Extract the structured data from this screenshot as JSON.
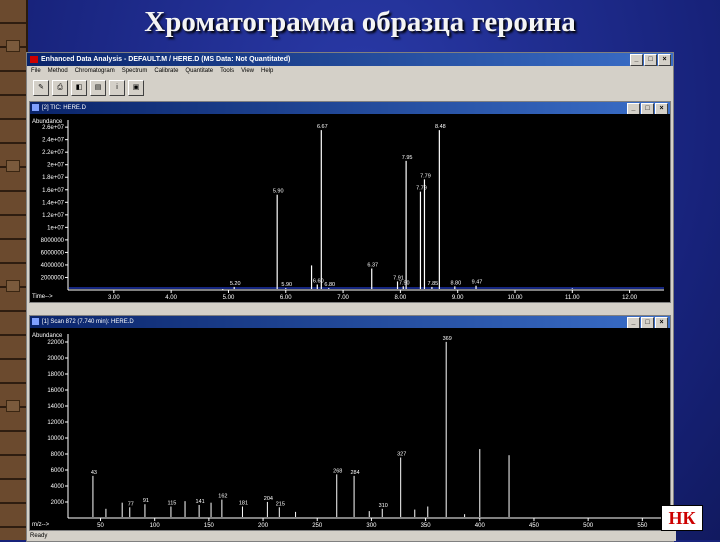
{
  "slide_title": "Хроматограмма образца героина",
  "app": {
    "window_title": "Enhanced Data Analysis - DEFAULT.M / HERE.D     (MS Data: Not Quantitated)",
    "menu": [
      "File",
      "Method",
      "Chromatogram",
      "Spectrum",
      "Calibrate",
      "Quantitate",
      "Tools",
      "View",
      "Help"
    ],
    "toolbar_buttons": [
      "tool-1",
      "tool-2",
      "tool-3",
      "tool-4",
      "tool-5",
      "tool-6"
    ],
    "status": "Ready"
  },
  "tic_window": {
    "title": "[2] TIC: HERE.D",
    "chart_data": {
      "type": "line",
      "title": "[2] TIC: HERE.D",
      "ylabel": "Abundance",
      "xlabel": "Time-->",
      "y_ticks": [
        "2.6e+07",
        "2.4e+07",
        "2.2e+07",
        "2e+07",
        "1.8e+07",
        "1.6e+07",
        "1.4e+07",
        "1.2e+07",
        "1e+07",
        "8000000",
        "6000000",
        "4000000",
        "2000000"
      ],
      "x_ticks": [
        "3.00",
        "4.00",
        "5.00",
        "6.00",
        "7.00",
        "8.00",
        "9.00",
        "10.00",
        "11.00",
        "12.00"
      ],
      "xlim": [
        2.2,
        12.6
      ],
      "ylim": [
        0,
        27000000
      ],
      "peaks": [
        {
          "x": 4.9,
          "y": 90000,
          "label": ""
        },
        {
          "x": 5.1,
          "y": 500000,
          "label": "5.20"
        },
        {
          "x": 5.85,
          "y": 15500000,
          "label": "5.90"
        },
        {
          "x": 6.0,
          "y": 300000,
          "label": "5.90"
        },
        {
          "x": 6.45,
          "y": 4000000,
          "label": ""
        },
        {
          "x": 6.55,
          "y": 900000,
          "label": "6.60"
        },
        {
          "x": 6.62,
          "y": 26000000,
          "label": "6.67"
        },
        {
          "x": 6.75,
          "y": 300000,
          "label": "6.80"
        },
        {
          "x": 7.5,
          "y": 3500000,
          "label": "6.37"
        },
        {
          "x": 7.95,
          "y": 1400000,
          "label": "7.91"
        },
        {
          "x": 8.05,
          "y": 600000,
          "label": "7.90"
        },
        {
          "x": 8.1,
          "y": 21000000,
          "label": "7.95"
        },
        {
          "x": 8.35,
          "y": 16000000,
          "label": "7.79"
        },
        {
          "x": 8.42,
          "y": 18000000,
          "label": "7.79"
        },
        {
          "x": 8.55,
          "y": 500000,
          "label": "7.85"
        },
        {
          "x": 8.68,
          "y": 26000000,
          "label": "8.48"
        },
        {
          "x": 8.95,
          "y": 600000,
          "label": "8.80"
        },
        {
          "x": 9.32,
          "y": 700000,
          "label": "9.47"
        },
        {
          "x": 11.0,
          "y": 250000,
          "label": ""
        }
      ]
    }
  },
  "scan_window": {
    "title": "[1] Scan 872 (7.740 min): HERE.D",
    "chart_data": {
      "type": "bar",
      "title": "[1] Scan 872 (7.740 min): HERE.D",
      "ylabel": "Abundance",
      "xlabel": "m/z-->",
      "y_ticks": [
        "22000",
        "20000",
        "18000",
        "16000",
        "14000",
        "12000",
        "10000",
        "8000",
        "6000",
        "4000",
        "2000"
      ],
      "x_ticks": [
        "50",
        "100",
        "150",
        "200",
        "250",
        "300",
        "350",
        "400",
        "450",
        "500",
        "550"
      ],
      "xlim": [
        20,
        570
      ],
      "ylim": [
        0,
        23500
      ],
      "peaks": [
        {
          "x": 43,
          "y": 5500,
          "label": "43"
        },
        {
          "x": 55,
          "y": 1200,
          "label": ""
        },
        {
          "x": 70,
          "y": 2000,
          "label": ""
        },
        {
          "x": 77,
          "y": 1400,
          "label": "77"
        },
        {
          "x": 91,
          "y": 1800,
          "label": "91"
        },
        {
          "x": 115,
          "y": 1500,
          "label": "115"
        },
        {
          "x": 128,
          "y": 2200,
          "label": ""
        },
        {
          "x": 141,
          "y": 1700,
          "label": "141"
        },
        {
          "x": 152,
          "y": 2000,
          "label": ""
        },
        {
          "x": 162,
          "y": 2400,
          "label": "162"
        },
        {
          "x": 181,
          "y": 1500,
          "label": "181"
        },
        {
          "x": 204,
          "y": 2100,
          "label": "204"
        },
        {
          "x": 215,
          "y": 1400,
          "label": "215"
        },
        {
          "x": 230,
          "y": 800,
          "label": ""
        },
        {
          "x": 268,
          "y": 5700,
          "label": "268"
        },
        {
          "x": 284,
          "y": 5500,
          "label": "284"
        },
        {
          "x": 298,
          "y": 900,
          "label": ""
        },
        {
          "x": 310,
          "y": 1200,
          "label": "310"
        },
        {
          "x": 327,
          "y": 7900,
          "label": "327"
        },
        {
          "x": 340,
          "y": 1100,
          "label": ""
        },
        {
          "x": 352,
          "y": 1500,
          "label": ""
        },
        {
          "x": 369,
          "y": 23000,
          "label": "369"
        },
        {
          "x": 386,
          "y": 500,
          "label": ""
        },
        {
          "x": 400,
          "y": 9000,
          "label": ""
        },
        {
          "x": 427,
          "y": 8200,
          "label": ""
        }
      ]
    }
  },
  "nk_label": "НК"
}
